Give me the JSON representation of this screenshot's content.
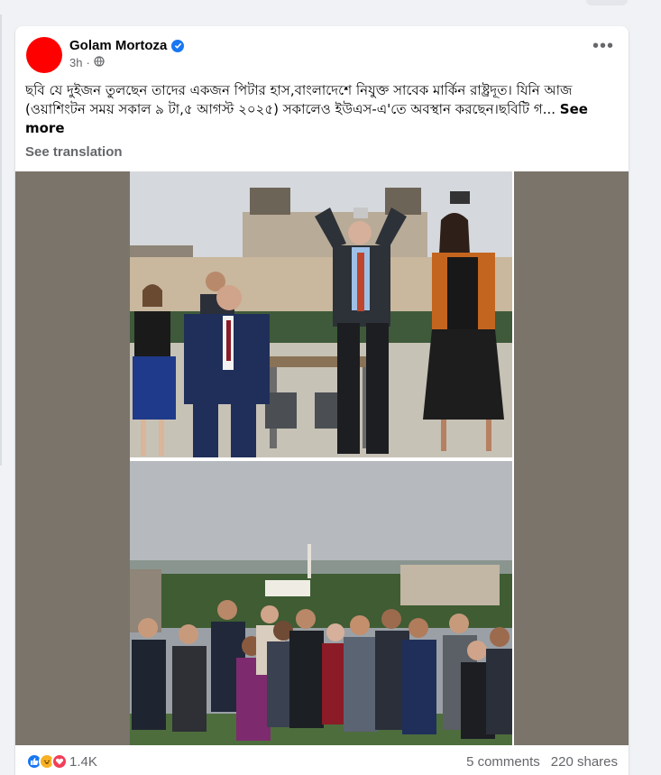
{
  "post": {
    "author": "Golam Mortoza",
    "time": "3h",
    "text": "ছবি যে দুইজন তুলছেন তাদের একজন পিটার হাস,বাংলাদেশে নিযুক্ত সাবেক মার্কিন রাষ্ট্রদূত। যিনি আজ (ওয়াশিংটন সময় সকাল ৯ টা,৫ আগস্ট ২০২৫) সকালেও ইউএস-এ'তে অবস্থান করছেন।ছবিটি গ...",
    "see_more_label": "See more",
    "see_translation_label": "See translation",
    "reaction_count": "1.4K",
    "comments_label": "5 comments",
    "shares_label": "220 shares"
  },
  "icons": {
    "verified": "verified-badge-icon",
    "privacy": "globe-icon",
    "menu": "more-options-icon",
    "reactions": [
      "like-icon",
      "haha-icon",
      "love-icon"
    ]
  },
  "colors": {
    "accent": "#1877f2",
    "avatar": "#ff0000",
    "media_background": "#7a746b"
  }
}
